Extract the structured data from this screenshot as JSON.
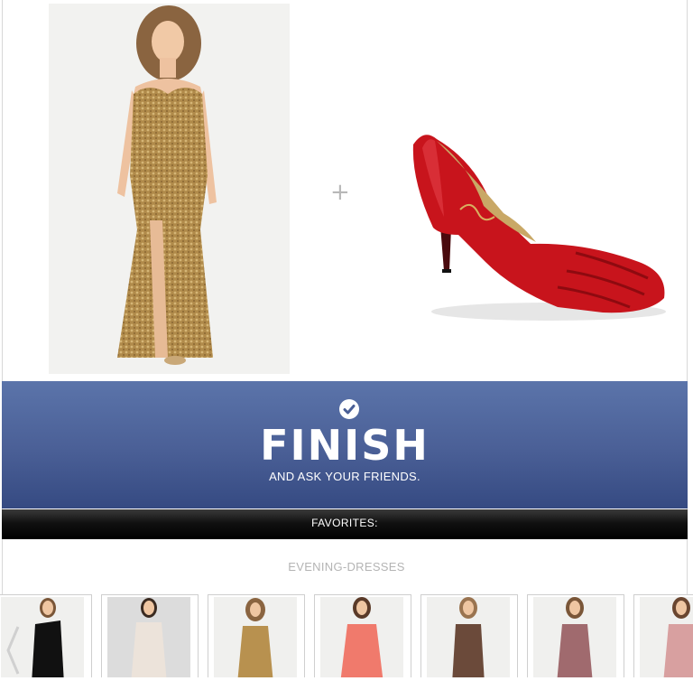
{
  "finish": {
    "title": "FINISH",
    "subtitle": "AND ASK YOUR FRIENDS."
  },
  "favorites": {
    "label": "FAVORITES:"
  },
  "category": {
    "label": "EVENING-DRESSES"
  },
  "colors": {
    "banner_top": "#5b74aa",
    "banner_bottom": "#354a82",
    "favorites_bar": "#000000",
    "shoe": "#c8141c",
    "dress": "#b08a4a"
  },
  "thumbnails": [
    {
      "dress_color": "#111111"
    },
    {
      "dress_color": "#ece3da"
    },
    {
      "dress_color": "#b8914f"
    },
    {
      "dress_color": "#f07a6c"
    },
    {
      "dress_color": "#6b4a3a"
    },
    {
      "dress_color": "#a06a6e"
    },
    {
      "dress_color": "#d8a0a0"
    }
  ]
}
